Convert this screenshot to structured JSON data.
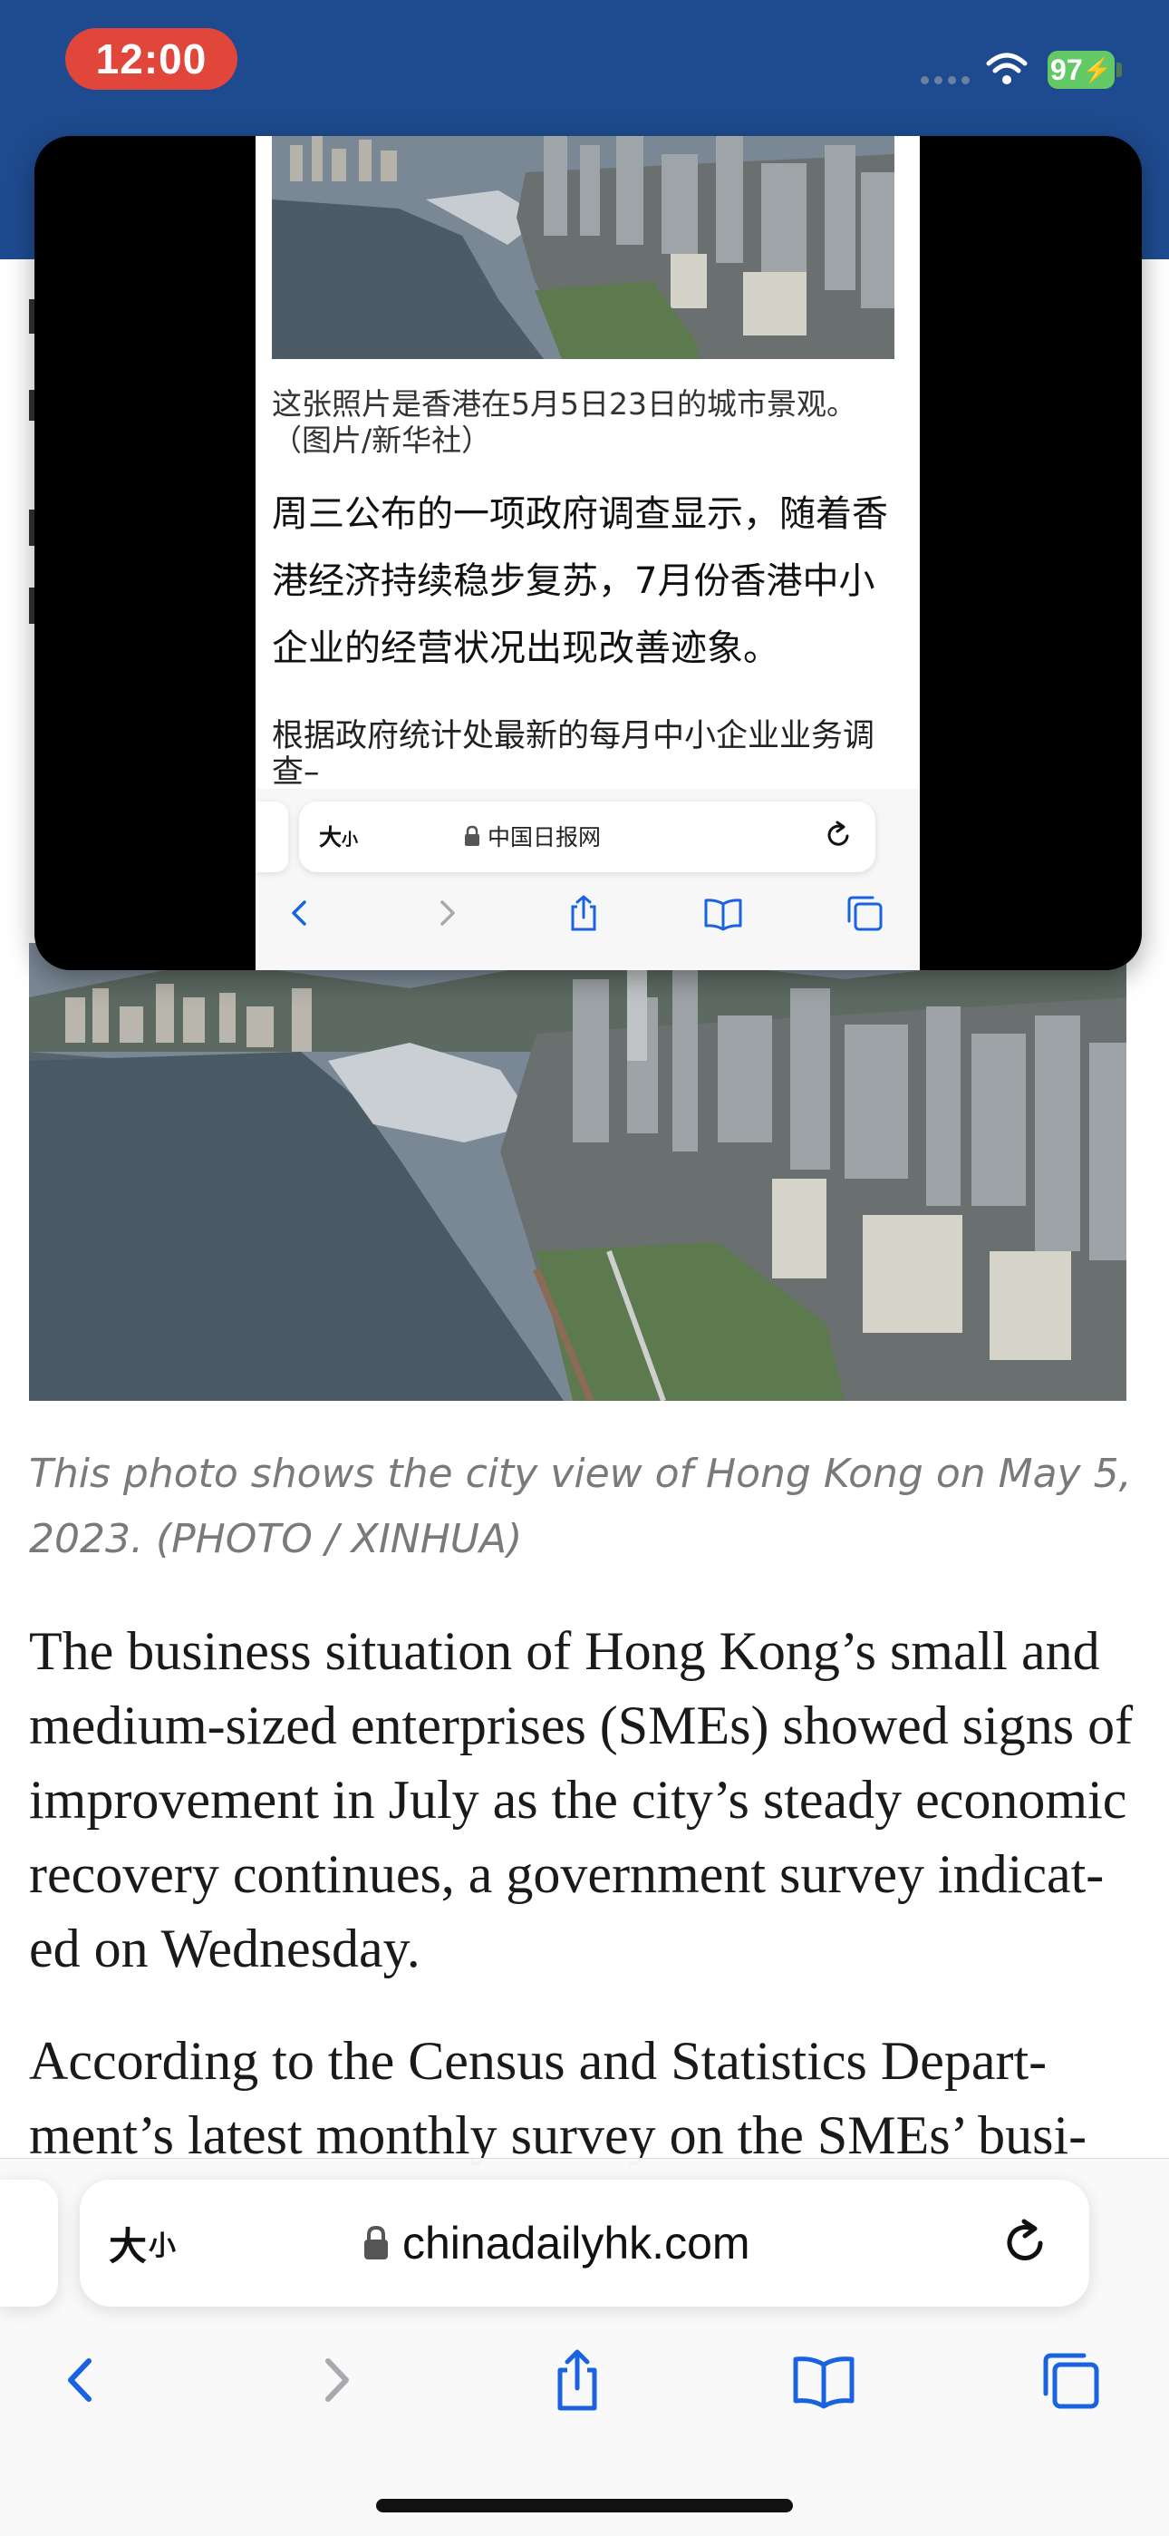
{
  "status_bar": {
    "time": "12:00",
    "battery": "97"
  },
  "article": {
    "caption": "This photo shows the city view of Hong Kong on May 5, 2023. (PHOTO / XINHUA)",
    "paragraph1": "The business situation of Hong Kong’s small and medium-sized enterprises (SMEs) showed signs of improvement in July as the city’s steady economic recovery continues, a government survey indicat- ed on Wednesday.",
    "paragraph2": "According to the Census and Statistics Depart- ment’s latest monthly survey on the SMEs’ busi-"
  },
  "browser": {
    "text_size_label": "大",
    "text_size_label_small": "小",
    "url": "chinadailyhk.com",
    "icons": [
      "lock-icon",
      "reload-icon",
      "back-icon",
      "forward-icon",
      "share-icon",
      "bookmarks-icon",
      "tabs-icon"
    ]
  },
  "video_overlay": {
    "caption": "这张照片是香港在5月5日23日的城市景观。（图片/新华社）",
    "paragraph1": "周三公布的一项政府调查显示，随着香港经济持续稳步复苏，7月份香港中小企业的经营状况出现改善迹象。",
    "paragraph2": "根据政府统计处最新的每月中小企业业务调查–",
    "text_size_label": "大",
    "text_size_label_small": "小",
    "url": "中国日报网"
  },
  "colors": {
    "header_blue": "#1e4b8f",
    "time_pill": "#e0463a",
    "battery": "#63c866",
    "toolbar_accent": "#1a63e0"
  }
}
